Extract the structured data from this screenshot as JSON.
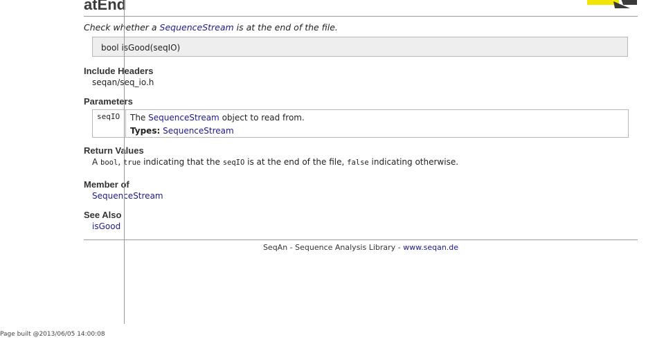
{
  "page": {
    "title": "atEnd",
    "summary_pre": "Check whether a ",
    "summary_link": "SequenceStream",
    "summary_post": " is at the end of the file."
  },
  "signature": "bool isGood(seqIO)",
  "include_headers": {
    "heading": "Include Headers",
    "items": [
      "seqan/seq_io.h"
    ]
  },
  "parameters": {
    "heading": "Parameters",
    "rows": [
      {
        "name": "seqIO",
        "desc_pre": "The ",
        "desc_link": "SequenceStream",
        "desc_post": " object to read from.",
        "types_label": "Types:",
        "types_value": "SequenceStream"
      }
    ]
  },
  "return_values": {
    "heading": "Return Values",
    "t1": "A ",
    "c1": "bool",
    "t2": ", ",
    "c2": "true",
    "t3": " indicating that the ",
    "c3": "seqIO",
    "t4": " is at the end of the file, ",
    "c4": "false",
    "t5": " indicating otherwise."
  },
  "member_of": {
    "heading": "Member of",
    "link": "SequenceStream"
  },
  "see_also": {
    "heading": "See Also",
    "link": "isGood"
  },
  "footer": {
    "text": "SeqAn - Sequence Analysis Library - ",
    "link": "www.seqan.de"
  },
  "build_info": "Page built @2013/06/05 14:00:08",
  "colors": {
    "link": "#1a1a8c",
    "logo_yellow": "#f2e600",
    "signature_bg": "#eeeeee"
  }
}
